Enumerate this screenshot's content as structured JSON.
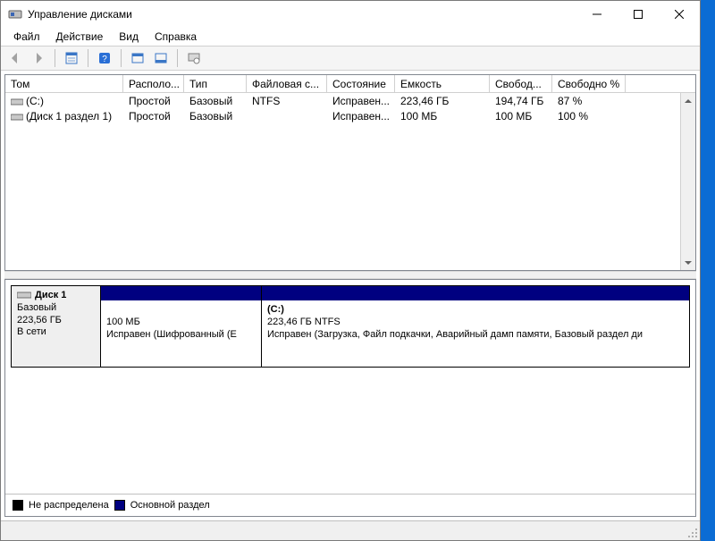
{
  "window": {
    "title": "Управление дисками"
  },
  "menu": {
    "file": "Файл",
    "action": "Действие",
    "view": "Вид",
    "help": "Справка"
  },
  "columns": {
    "tom": "Том",
    "raspolog": "Располо...",
    "tip": "Тип",
    "fs": "Файловая с...",
    "sost": "Состояние",
    "emk": "Емкость",
    "svob": "Свобод...",
    "svobp": "Свободно %"
  },
  "volumes": [
    {
      "name": "(C:)",
      "raspolog": "Простой",
      "tip": "Базовый",
      "fs": "NTFS",
      "sost": "Исправен...",
      "emk": "223,46 ГБ",
      "svob": "194,74 ГБ",
      "svobp": "87 %"
    },
    {
      "name": "(Диск 1 раздел 1)",
      "raspolog": "Простой",
      "tip": "Базовый",
      "fs": "",
      "sost": "Исправен...",
      "emk": "100 МБ",
      "svob": "100 МБ",
      "svobp": "100 %"
    }
  ],
  "disk": {
    "name": "Диск 1",
    "type": "Базовый",
    "size": "223,56 ГБ",
    "status": "В сети"
  },
  "partitions": {
    "p1_size": "100 МБ",
    "p1_status": "Исправен (Шифрованный (E",
    "p2_title": "(C:)",
    "p2_size": "223,46 ГБ NTFS",
    "p2_status": "Исправен (Загрузка, Файл подкачки, Аварийный дамп памяти, Базовый раздел ди"
  },
  "legend": {
    "unalloc": "Не распределена",
    "primary": "Основной раздел"
  }
}
